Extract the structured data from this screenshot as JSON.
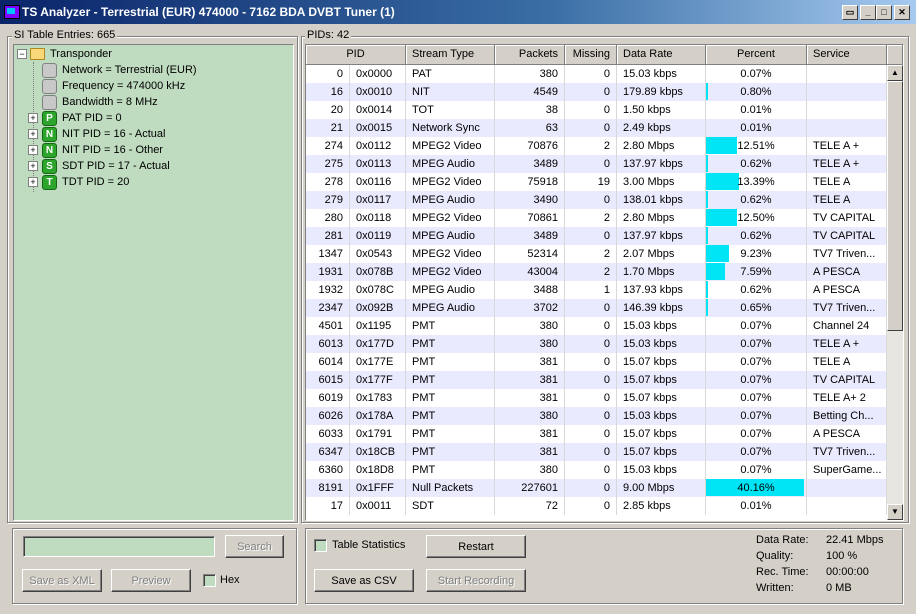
{
  "window": {
    "title": "TS Analyzer - Terrestrial (EUR) 474000 - 7162 BDA DVBT Tuner (1)",
    "controls": [
      "restore-down",
      "minimize",
      "maximize",
      "close"
    ]
  },
  "left_panel": {
    "label": "SI Table Entries: 665",
    "tree": [
      {
        "label": "Transponder",
        "icon": "folder-icon",
        "expander": "−"
      },
      {
        "label": "Network = Terrestrial (EUR)",
        "icon": "grey-box-icon"
      },
      {
        "label": "Frequency = 474000 kHz",
        "icon": "grey-box-icon"
      },
      {
        "label": "Bandwidth = 8 MHz",
        "icon": "grey-box-icon"
      },
      {
        "label": "PAT PID = 0",
        "icon": "P",
        "expander": "+"
      },
      {
        "label": "NIT PID = 16 - Actual",
        "icon": "N",
        "expander": "+"
      },
      {
        "label": "NIT PID = 16 - Other",
        "icon": "N",
        "expander": "+"
      },
      {
        "label": "SDT PID = 17 - Actual",
        "icon": "S",
        "expander": "+"
      },
      {
        "label": "TDT PID = 20",
        "icon": "T",
        "expander": "+"
      }
    ],
    "search_value": "",
    "search_button": "Search",
    "save_xml_button": "Save as XML",
    "preview_button": "Preview",
    "hex_label": "Hex"
  },
  "right_panel": {
    "label": "PIDs: 42",
    "columns": [
      "PID",
      "Stream Type",
      "Packets",
      "Missing",
      "Data Rate",
      "Percent",
      "Service"
    ],
    "rows": [
      {
        "pid": "0",
        "hex": "0x0000",
        "type": "PAT",
        "packets": "380",
        "missing": "0",
        "rate": "15.03 kbps",
        "percent": "0.07%",
        "pct": 0.07,
        "service": ""
      },
      {
        "pid": "16",
        "hex": "0x0010",
        "type": "NIT",
        "packets": "4549",
        "missing": "0",
        "rate": "179.89 kbps",
        "percent": "0.80%",
        "pct": 0.8,
        "service": ""
      },
      {
        "pid": "20",
        "hex": "0x0014",
        "type": "TOT",
        "packets": "38",
        "missing": "0",
        "rate": "1.50 kbps",
        "percent": "0.01%",
        "pct": 0.01,
        "service": ""
      },
      {
        "pid": "21",
        "hex": "0x0015",
        "type": "Network Sync",
        "packets": "63",
        "missing": "0",
        "rate": "2.49 kbps",
        "percent": "0.01%",
        "pct": 0.01,
        "service": ""
      },
      {
        "pid": "274",
        "hex": "0x0112",
        "type": "MPEG2 Video",
        "packets": "70876",
        "missing": "2",
        "rate": "2.80 Mbps",
        "percent": "12.51%",
        "pct": 12.51,
        "service": "TELE A +"
      },
      {
        "pid": "275",
        "hex": "0x0113",
        "type": "MPEG Audio",
        "packets": "3489",
        "missing": "0",
        "rate": "137.97 kbps",
        "percent": "0.62%",
        "pct": 0.62,
        "service": "TELE A +"
      },
      {
        "pid": "278",
        "hex": "0x0116",
        "type": "MPEG2 Video",
        "packets": "75918",
        "missing": "19",
        "rate": "3.00 Mbps",
        "percent": "13.39%",
        "pct": 13.39,
        "service": "TELE A"
      },
      {
        "pid": "279",
        "hex": "0x0117",
        "type": "MPEG Audio",
        "packets": "3490",
        "missing": "0",
        "rate": "138.01 kbps",
        "percent": "0.62%",
        "pct": 0.62,
        "service": "TELE A"
      },
      {
        "pid": "280",
        "hex": "0x0118",
        "type": "MPEG2 Video",
        "packets": "70861",
        "missing": "2",
        "rate": "2.80 Mbps",
        "percent": "12.50%",
        "pct": 12.5,
        "service": "TV CAPITAL"
      },
      {
        "pid": "281",
        "hex": "0x0119",
        "type": "MPEG Audio",
        "packets": "3489",
        "missing": "0",
        "rate": "137.97 kbps",
        "percent": "0.62%",
        "pct": 0.62,
        "service": "TV CAPITAL"
      },
      {
        "pid": "1347",
        "hex": "0x0543",
        "type": "MPEG2 Video",
        "packets": "52314",
        "missing": "2",
        "rate": "2.07 Mbps",
        "percent": "9.23%",
        "pct": 9.23,
        "service": "TV7 Triven..."
      },
      {
        "pid": "1931",
        "hex": "0x078B",
        "type": "MPEG2 Video",
        "packets": "43004",
        "missing": "2",
        "rate": "1.70 Mbps",
        "percent": "7.59%",
        "pct": 7.59,
        "service": "A PESCA"
      },
      {
        "pid": "1932",
        "hex": "0x078C",
        "type": "MPEG Audio",
        "packets": "3488",
        "missing": "1",
        "rate": "137.93 kbps",
        "percent": "0.62%",
        "pct": 0.62,
        "service": "A PESCA"
      },
      {
        "pid": "2347",
        "hex": "0x092B",
        "type": "MPEG Audio",
        "packets": "3702",
        "missing": "0",
        "rate": "146.39 kbps",
        "percent": "0.65%",
        "pct": 0.65,
        "service": "TV7 Triven..."
      },
      {
        "pid": "4501",
        "hex": "0x1195",
        "type": "PMT",
        "packets": "380",
        "missing": "0",
        "rate": "15.03 kbps",
        "percent": "0.07%",
        "pct": 0.07,
        "service": "Channel 24"
      },
      {
        "pid": "6013",
        "hex": "0x177D",
        "type": "PMT",
        "packets": "380",
        "missing": "0",
        "rate": "15.03 kbps",
        "percent": "0.07%",
        "pct": 0.07,
        "service": "TELE A +"
      },
      {
        "pid": "6014",
        "hex": "0x177E",
        "type": "PMT",
        "packets": "381",
        "missing": "0",
        "rate": "15.07 kbps",
        "percent": "0.07%",
        "pct": 0.07,
        "service": "TELE A"
      },
      {
        "pid": "6015",
        "hex": "0x177F",
        "type": "PMT",
        "packets": "381",
        "missing": "0",
        "rate": "15.07 kbps",
        "percent": "0.07%",
        "pct": 0.07,
        "service": "TV CAPITAL"
      },
      {
        "pid": "6019",
        "hex": "0x1783",
        "type": "PMT",
        "packets": "381",
        "missing": "0",
        "rate": "15.07 kbps",
        "percent": "0.07%",
        "pct": 0.07,
        "service": "TELE A+ 2"
      },
      {
        "pid": "6026",
        "hex": "0x178A",
        "type": "PMT",
        "packets": "380",
        "missing": "0",
        "rate": "15.03 kbps",
        "percent": "0.07%",
        "pct": 0.07,
        "service": "Betting Ch..."
      },
      {
        "pid": "6033",
        "hex": "0x1791",
        "type": "PMT",
        "packets": "381",
        "missing": "0",
        "rate": "15.07 kbps",
        "percent": "0.07%",
        "pct": 0.07,
        "service": "A PESCA"
      },
      {
        "pid": "6347",
        "hex": "0x18CB",
        "type": "PMT",
        "packets": "381",
        "missing": "0",
        "rate": "15.07 kbps",
        "percent": "0.07%",
        "pct": 0.07,
        "service": "TV7 Triven..."
      },
      {
        "pid": "6360",
        "hex": "0x18D8",
        "type": "PMT",
        "packets": "380",
        "missing": "0",
        "rate": "15.03 kbps",
        "percent": "0.07%",
        "pct": 0.07,
        "service": "SuperGame..."
      },
      {
        "pid": "8191",
        "hex": "0x1FFF",
        "type": "Null Packets",
        "packets": "227601",
        "missing": "0",
        "rate": "9.00 Mbps",
        "percent": "40.16%",
        "pct": 40.16,
        "service": ""
      },
      {
        "pid": "17",
        "hex": "0x0011",
        "type": "SDT",
        "packets": "72",
        "missing": "0",
        "rate": "2.85 kbps",
        "percent": "0.01%",
        "pct": 0.01,
        "service": ""
      }
    ],
    "table_statistics_label": "Table Statistics",
    "restart_button": "Restart",
    "save_csv_button": "Save as CSV",
    "start_recording_button": "Start Recording",
    "stats": [
      {
        "label": "Data Rate:",
        "value": "22.41 Mbps"
      },
      {
        "label": "Quality:",
        "value": "100 %"
      },
      {
        "label": "Rec. Time:",
        "value": "00:00:00"
      },
      {
        "label": "Written:",
        "value": "0 MB"
      }
    ]
  },
  "colors": {
    "title_start": "#0a246a",
    "tree_bg": "#c0dcc0",
    "percent_bar": "#00e5f5",
    "alt_row": "#eaeaff"
  }
}
